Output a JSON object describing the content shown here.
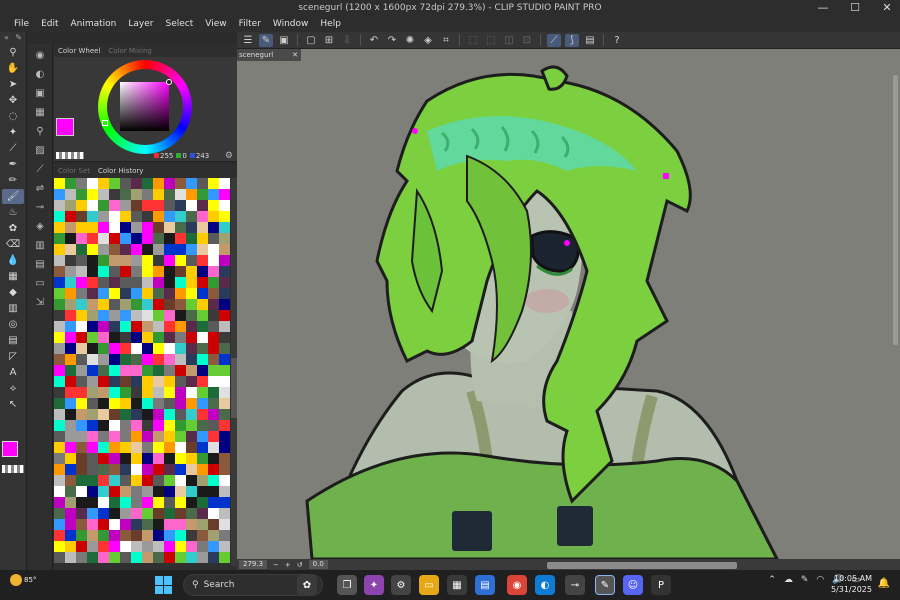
{
  "window": {
    "title": "scenegurl (1200 x 1600px 72dpi 279.3%) - CLIP STUDIO PAINT PRO",
    "minimize": "—",
    "maximize": "☐",
    "close": "✕"
  },
  "menu": [
    "File",
    "Edit",
    "Animation",
    "Layer",
    "Select",
    "View",
    "Filter",
    "Window",
    "Help"
  ],
  "color_panel": {
    "tab_wheel": "Color Wheel",
    "tab_mixing": "Color Mixing",
    "r": "255",
    "g": "0",
    "b": "243",
    "main_color": "#ff00ff"
  },
  "color_set_panel": {
    "tab_set": "Color Set",
    "tab_history": "Color History"
  },
  "document": {
    "tab": "scenegurl",
    "tab_close": "✕",
    "zoom": "279.3",
    "angle": "0.0"
  },
  "taskbar": {
    "weather_temp": "85°",
    "search_placeholder": "Search",
    "time": "10:05 AM",
    "date": "5/31/2025"
  },
  "colors": {
    "hair": "#7ccf3f",
    "hair_highlight": "#5fd8a6",
    "shirt": "#6fb24d",
    "skin": "#b5bfae",
    "background": "#7f7f7a"
  }
}
